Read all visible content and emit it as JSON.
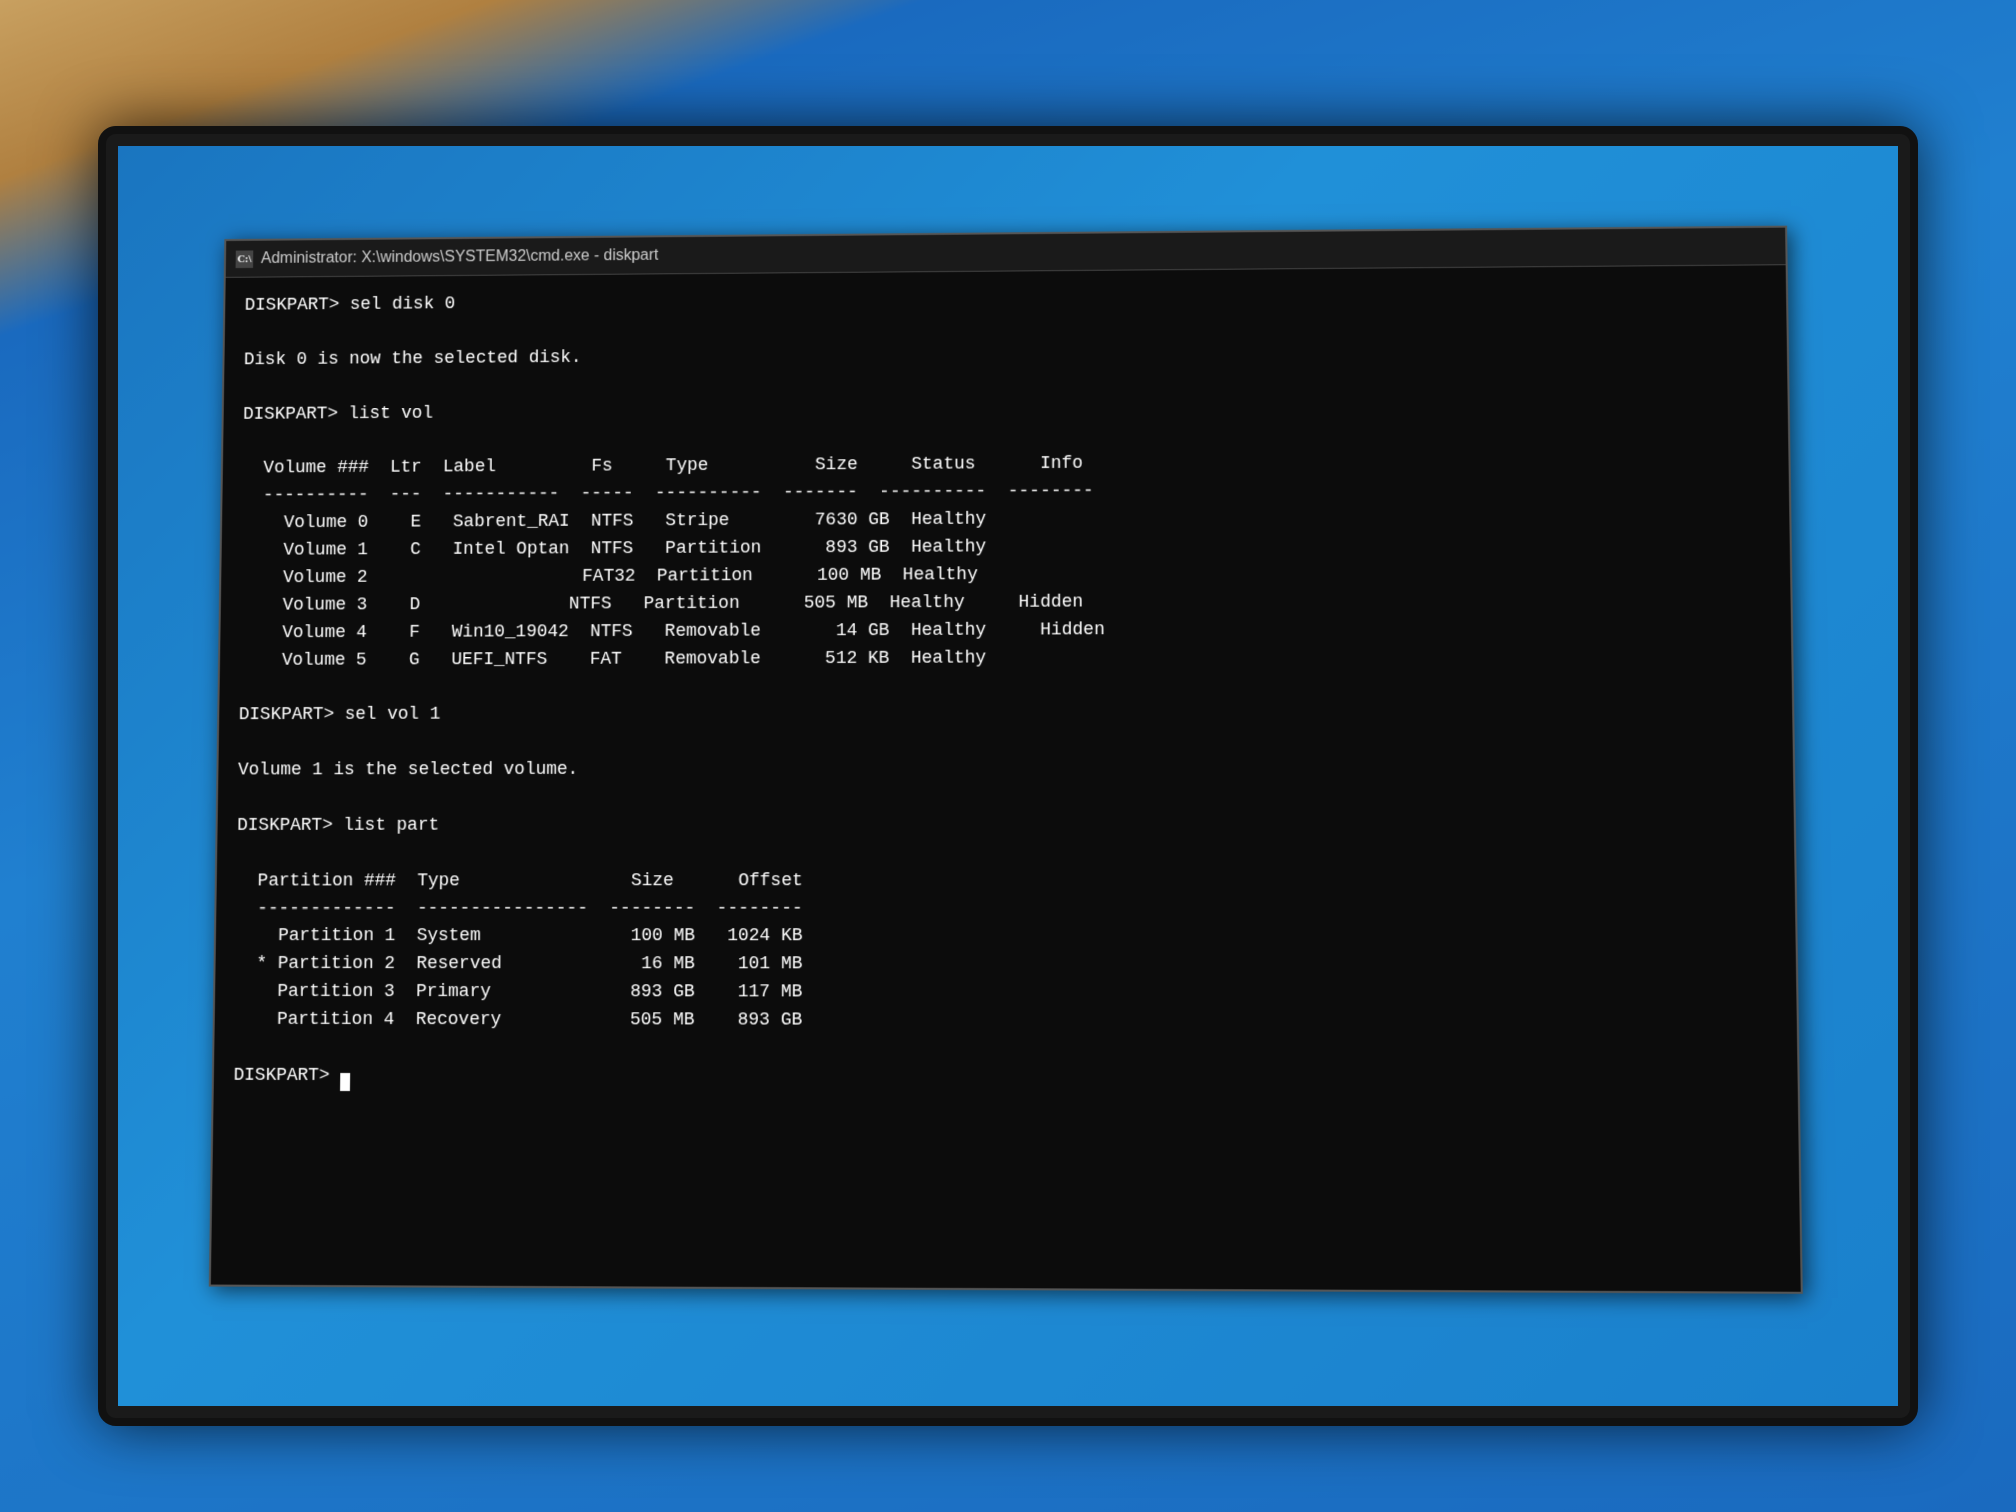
{
  "window": {
    "title": "Administrator: X:\\windows\\SYSTEM32\\cmd.exe - diskpart",
    "title_icon": "C"
  },
  "terminal": {
    "lines": [
      "",
      "DISKPART> sel disk 0",
      "",
      "Disk 0 is now the selected disk.",
      "",
      "DISKPART> list vol",
      ""
    ],
    "vol_table": {
      "headers": [
        "Volume ###",
        "Ltr",
        "Label",
        "Fs",
        "Type",
        "Size",
        "Status",
        "Info"
      ],
      "separator": [
        "----------",
        "---",
        "-----------",
        "-----",
        "----------",
        "-------",
        "----------",
        "--------"
      ],
      "rows": [
        [
          "Volume 0",
          "E",
          "Sabrent_RAI",
          "NTFS",
          "Stripe",
          "7630 GB",
          "Healthy",
          ""
        ],
        [
          "Volume 1",
          "C",
          "Intel Optan",
          "NTFS",
          "Partition",
          "893 GB",
          "Healthy",
          ""
        ],
        [
          "Volume 2",
          "",
          "",
          "FAT32",
          "Partition",
          "100 MB",
          "Healthy",
          ""
        ],
        [
          "Volume 3",
          "D",
          "",
          "NTFS",
          "Partition",
          "505 MB",
          "Healthy",
          "Hidden"
        ],
        [
          "Volume 4",
          "F",
          "Win10_19042",
          "NTFS",
          "Removable",
          "14 GB",
          "Healthy",
          "Hidden"
        ],
        [
          "Volume 5",
          "G",
          "UEFI_NTFS",
          "FAT",
          "Removable",
          "512 KB",
          "Healthy",
          ""
        ]
      ]
    },
    "after_vol": [
      "",
      "DISKPART> sel vol 1",
      "",
      "Volume 1 is the selected volume.",
      "",
      "DISKPART> list part",
      ""
    ],
    "part_table": {
      "headers": [
        "Partition ###",
        "Type",
        "Size",
        "Offset"
      ],
      "separator": [
        "-------------",
        "----------------",
        "-------",
        "-------"
      ],
      "rows": [
        [
          "  Partition 1",
          "System",
          "100 MB",
          "1024 KB"
        ],
        [
          "* Partition 2",
          "Reserved",
          "16 MB",
          "101 MB"
        ],
        [
          "  Partition 3",
          "Primary",
          "893 GB",
          "117 MB"
        ],
        [
          "  Partition 4",
          "Recovery",
          "505 MB",
          "893 GB"
        ]
      ]
    },
    "prompt_final": "DISKPART> "
  }
}
